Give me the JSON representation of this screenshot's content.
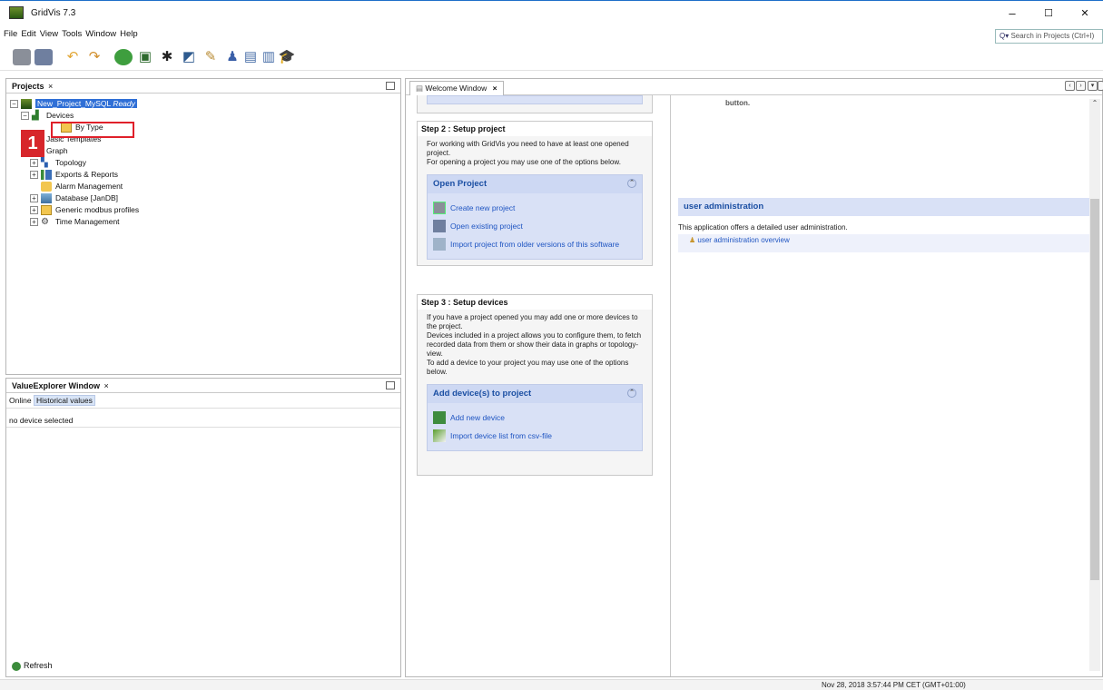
{
  "window": {
    "title": "GridVis 7.3",
    "controls": {
      "minimize": "–",
      "maximize": "☐",
      "close": "✕"
    }
  },
  "menu": [
    "File",
    "Edit",
    "View",
    "Tools",
    "Window",
    "Help"
  ],
  "search": {
    "placeholder": "Search in Projects (Ctrl+I)"
  },
  "projects_panel": {
    "title": "Projects",
    "close": "×",
    "tree": [
      {
        "label": "New_Project_MySQL",
        "suffix": "Ready",
        "level": 0,
        "icon": "project-icon",
        "expand": "−"
      },
      {
        "label": "Devices",
        "level": 1,
        "icon": "devices-icon",
        "expand": "−"
      },
      {
        "label": "By Type",
        "level": 2,
        "icon": "folder-icon"
      },
      {
        "label": "Jasic Templates",
        "level": 1,
        "icon": "template-icon"
      },
      {
        "label": "Graph",
        "level": 1,
        "icon": "graph-icon"
      },
      {
        "label": "Topology",
        "level": 1,
        "icon": "topology-icon",
        "expand": "+"
      },
      {
        "label": "Exports & Reports",
        "level": 1,
        "icon": "reports-icon",
        "expand": "+"
      },
      {
        "label": "Alarm Management",
        "level": 1,
        "icon": "alarm-icon"
      },
      {
        "label": "Database [JanDB]",
        "level": 1,
        "icon": "database-icon",
        "expand": "+"
      },
      {
        "label": "Generic modbus profiles",
        "level": 1,
        "icon": "folder-icon",
        "expand": "+"
      },
      {
        "label": "Time Management",
        "level": 1,
        "icon": "time-icon",
        "expand": "+"
      }
    ]
  },
  "callout": {
    "number": "1"
  },
  "value_explorer": {
    "title": "ValueExplorer Window",
    "close": "×",
    "tabs": [
      "Online",
      "Historical values"
    ],
    "status": "no device selected",
    "refresh": "Refresh"
  },
  "welcome": {
    "tab_title": "Welcome Window",
    "close": "×",
    "partial_text": "button.",
    "step2": {
      "title": "Step 2 : Setup project",
      "desc": "For working with GridVis you need to have at least one opened project.\nFor opening a project you may use one of the options below.",
      "section": "Open Project",
      "links": [
        "Create new project",
        "Open existing project",
        "Import project from older versions of this software"
      ]
    },
    "step3": {
      "title": "Step 3 : Setup devices",
      "desc": "If you have a project opened you may add one or more devices to the project.\nDevices included in a project allows you to configure them, to fetch recorded data from them or show their data in graphs or topology-view.\nTo add a device to your project you may use one of the options below.",
      "section": "Add device(s) to project",
      "links": [
        "Add new device",
        "Import device list from csv-file"
      ]
    },
    "user_admin": {
      "title": "user administration",
      "text": "This application offers a detailed user administration.",
      "link": "user administration overview"
    }
  },
  "status_bar": {
    "time": "Nov 28, 2018 3:57:44 PM CET (GMT+01:00)"
  }
}
